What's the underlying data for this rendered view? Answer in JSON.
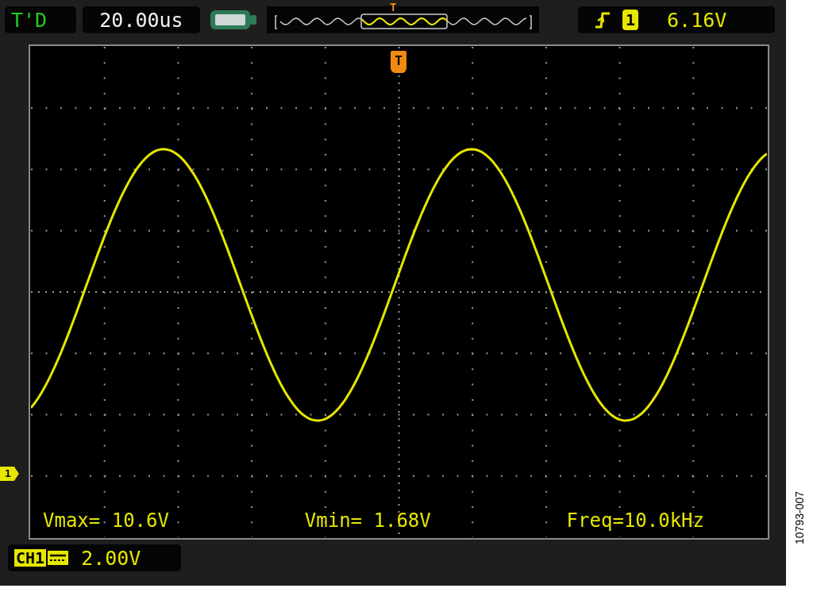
{
  "status_bar": {
    "mode": "T'D",
    "timebase": "20.00us",
    "trigger_position_label": "T",
    "trigger_channel": "1",
    "trigger_level": "6.16V"
  },
  "trigger_marker": "T",
  "channel_marker": "1",
  "measurements": [
    {
      "text": "Vmax= 10.6V"
    },
    {
      "text": "Vmin= 1.68V"
    },
    {
      "text": "Freq=10.0kHz"
    }
  ],
  "channel": {
    "name": "CH1",
    "scale": "2.00V"
  },
  "figure_number": "10793-007"
}
